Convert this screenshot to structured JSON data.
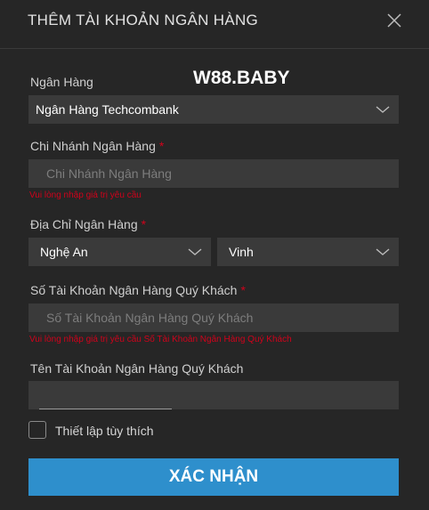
{
  "dialog": {
    "title": "THÊM TÀI KHOẢN NGÂN HÀNG",
    "close_icon": "close-icon"
  },
  "brand_watermark": "W88.BABY",
  "bank": {
    "label": "Ngân Hàng",
    "value": "Ngân Hàng Techcombank"
  },
  "branch": {
    "label": "Chi Nhánh Ngân Hàng",
    "required_mark": "*",
    "placeholder": "Chi Nhánh Ngân Hàng",
    "value": "",
    "error": "Vui lòng nhập giá trị yêu cầu"
  },
  "address": {
    "label": "Địa Chỉ Ngân Hàng",
    "required_mark": "*",
    "province": "Nghệ An",
    "city": "Vinh"
  },
  "account_number": {
    "label": "Số Tài Khoản Ngân Hàng Quý Khách",
    "required_mark": "*",
    "placeholder": "Số Tài Khoản Ngân Hàng Quý Khách",
    "value": "",
    "error": "Vui lòng nhập giá trị yêu cầu Số Tài Khoản Ngân Hàng Quý Khách"
  },
  "account_name": {
    "label": "Tên Tài Khoản Ngân Hàng Quý Khách",
    "value": ""
  },
  "preference": {
    "label": "Thiết lập tùy thích",
    "checked": false
  },
  "submit_label": "XÁC NHẬN",
  "colors": {
    "background": "#262626",
    "field": "#3a3a3a",
    "error": "#d0021b",
    "primary_button": "#2e8fcc"
  }
}
